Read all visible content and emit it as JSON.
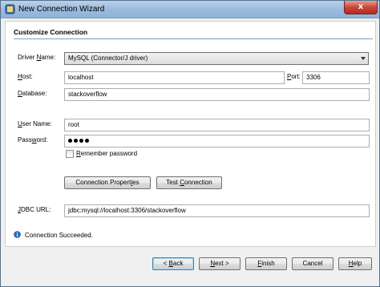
{
  "window": {
    "title": "New Connection Wizard",
    "close_label": "x",
    "icon": "netbeans-wizard-icon"
  },
  "section": {
    "title": "Customize Connection"
  },
  "form": {
    "driver_label": "Driver Name:",
    "driver_value": "MySQL (Connector/J driver)",
    "host_label": "Host:",
    "host_value": "localhost",
    "port_label": "Port:",
    "port_value": "3306",
    "database_label": "Database:",
    "database_value": "stackoverflow",
    "username_label": "User Name:",
    "username_value": "root",
    "password_label": "Password:",
    "password_length": 4,
    "remember_label": "Remember password",
    "remember_checked": false,
    "conn_props_label": "Connection Properties",
    "test_conn_label": "Test Connection",
    "jdbc_label": "JDBC URL:",
    "jdbc_value": "jdbc:mysql://localhost:3306/stackoverflow"
  },
  "status": {
    "icon": "info-icon",
    "text": "Connection Succeeded."
  },
  "buttons": {
    "back": "< Back",
    "next": "Next >",
    "finish": "Finish",
    "cancel": "Cancel",
    "help": "Help"
  },
  "colors": {
    "titlebar": "#9dbbdd",
    "close": "#c8473a",
    "panel_bg": "#ffffff",
    "dialog_bg": "#f0f0f0",
    "info": "#2b6cc4"
  }
}
